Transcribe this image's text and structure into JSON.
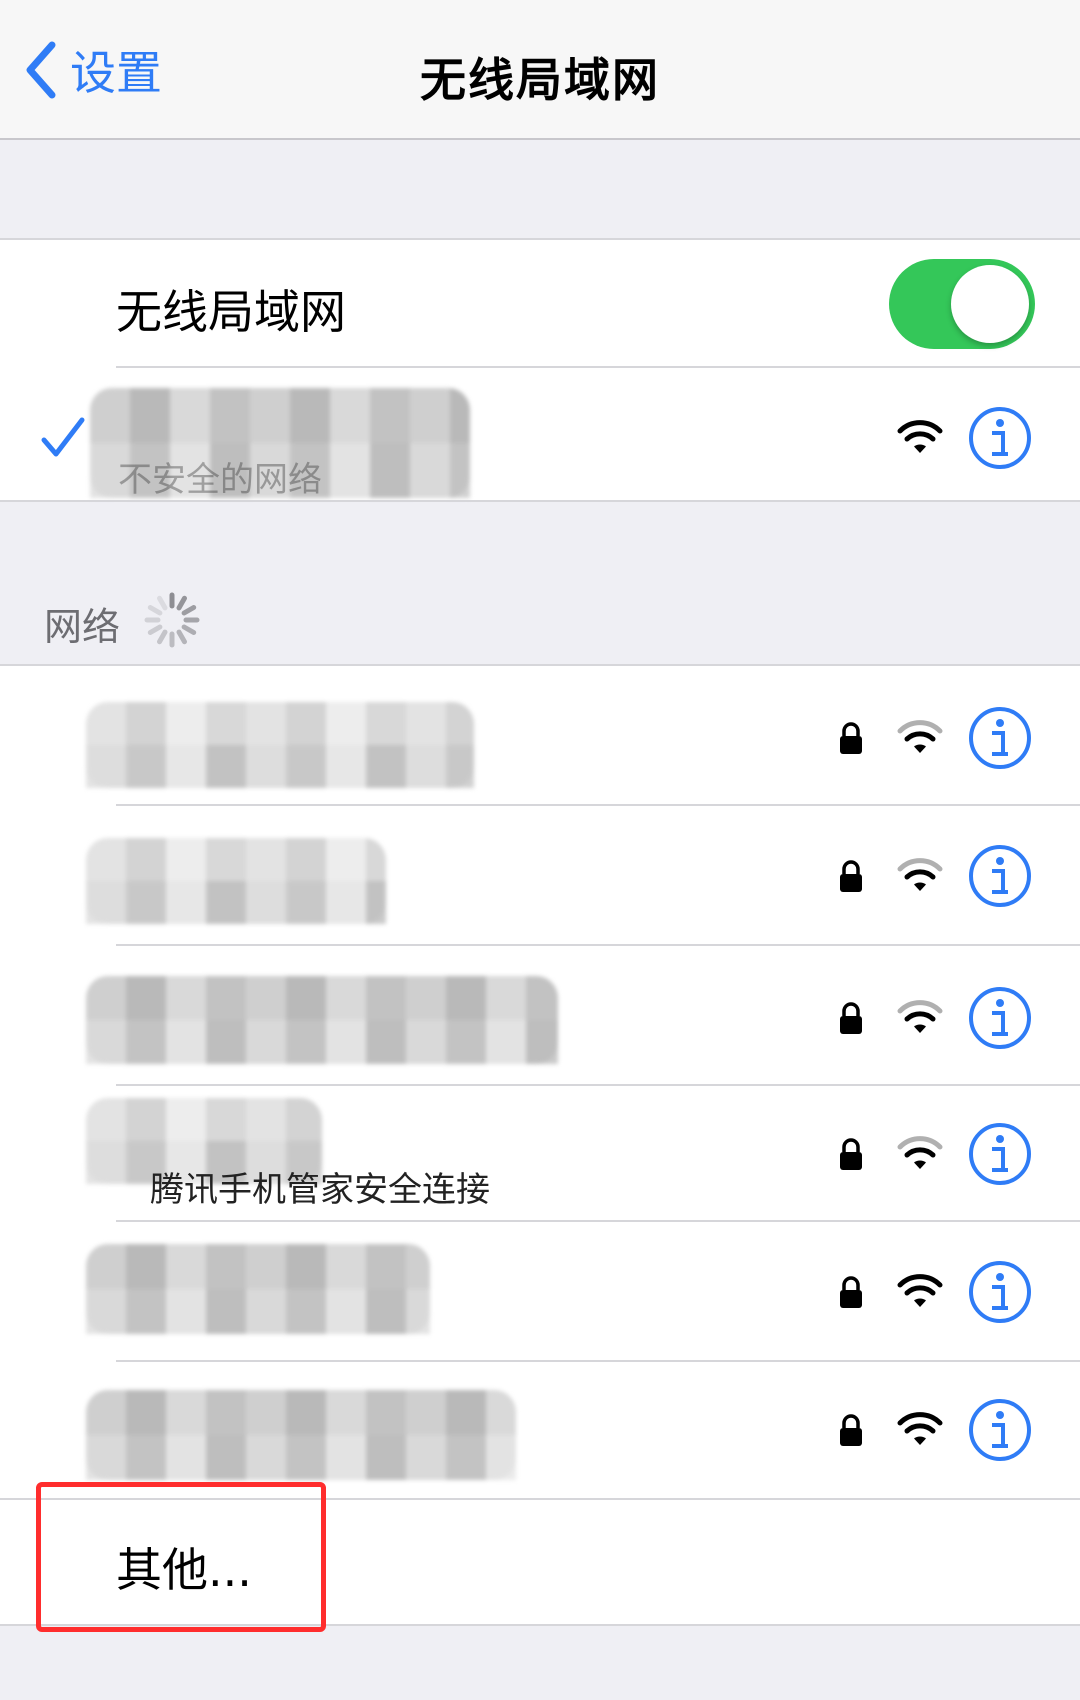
{
  "navbar": {
    "back_label": "设置",
    "title": "无线局域网"
  },
  "wifi_toggle": {
    "label": "无线局域网",
    "on": true,
    "color": "#34c759"
  },
  "connected_network": {
    "subtitle": "不安全的网络"
  },
  "networks_section": {
    "header": "网络"
  },
  "networks": [
    {
      "secured": true,
      "signal": 2
    },
    {
      "secured": true,
      "signal": 2
    },
    {
      "secured": true,
      "signal": 2
    },
    {
      "secured": true,
      "signal": 2,
      "subtitle": "腾讯手机管家安全连接"
    },
    {
      "secured": true,
      "signal": 3
    },
    {
      "secured": true,
      "signal": 3
    }
  ],
  "other": {
    "label": "其他..."
  },
  "colors": {
    "accent": "#2f7cf6",
    "highlight": "#ff2d2d"
  }
}
